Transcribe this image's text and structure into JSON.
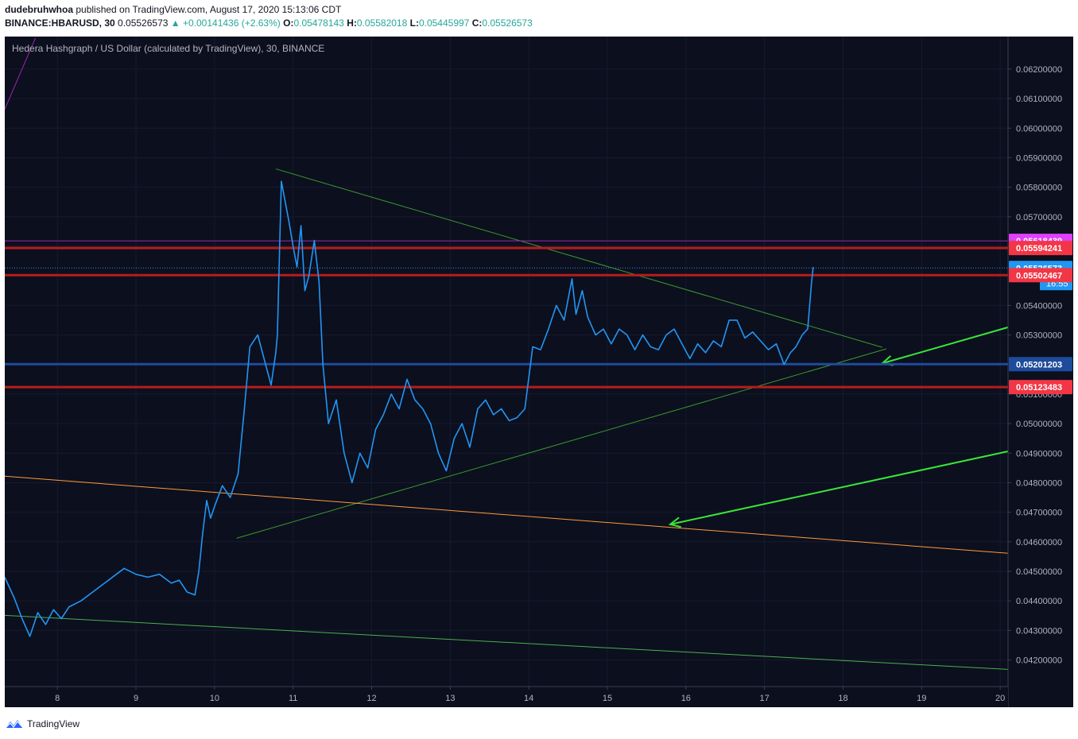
{
  "header": {
    "publisher": "dudebruhwhoa",
    "published_text": "published on TradingView.com, August 17, 2020 15:13:06 CDT",
    "symbol": "BINANCE:HBARUSD, 30",
    "last": "0.05526573",
    "change": "▲ +0.00141436 (+2.63%)",
    "o_label": "O:",
    "o_val": "0.05478143",
    "h_label": "H:",
    "h_val": "0.05582018",
    "l_label": "L:",
    "l_val": "0.05445997",
    "c_label": "C:",
    "c_val": "0.05526573"
  },
  "chart_title": "Hedera Hashgraph / US Dollar (calculated by TradingView), 30, BINANCE",
  "footer": {
    "brand": "TradingView"
  },
  "chart_data": {
    "type": "line",
    "xlabel": "",
    "ylabel": "",
    "xlim": [
      7.33,
      20.1
    ],
    "ylim": [
      0.0411,
      0.0631
    ],
    "x_ticks": [
      "8",
      "9",
      "10",
      "11",
      "12",
      "13",
      "14",
      "15",
      "16",
      "17",
      "18",
      "19",
      "20"
    ],
    "x_tick_values": [
      8,
      9,
      10,
      11,
      12,
      13,
      14,
      15,
      16,
      17,
      18,
      19,
      20
    ],
    "y_ticks": [
      "0.04200000",
      "0.04300000",
      "0.04400000",
      "0.04500000",
      "0.04600000",
      "0.04700000",
      "0.04800000",
      "0.04900000",
      "0.05000000",
      "0.05100000",
      "0.05200000",
      "0.05300000",
      "0.05400000",
      "0.05500000",
      "0.05600000",
      "0.05700000",
      "0.05800000",
      "0.05900000",
      "0.06000000",
      "0.06100000",
      "0.06200000"
    ],
    "y_tick_values": [
      0.042,
      0.043,
      0.044,
      0.045,
      0.046,
      0.047,
      0.048,
      0.049,
      0.05,
      0.051,
      0.052,
      0.053,
      0.054,
      0.055,
      0.056,
      0.057,
      0.058,
      0.059,
      0.06,
      0.061,
      0.062
    ],
    "series": [
      {
        "color": "#2196f3",
        "x": [
          7.33,
          7.45,
          7.55,
          7.65,
          7.75,
          7.85,
          7.95,
          8.05,
          8.15,
          8.3,
          8.45,
          8.6,
          8.75,
          8.85,
          9.0,
          9.15,
          9.3,
          9.45,
          9.55,
          9.65,
          9.75,
          9.8,
          9.85,
          9.9,
          9.95,
          10.0,
          10.1,
          10.2,
          10.3,
          10.38,
          10.45,
          10.55,
          10.65,
          10.72,
          10.78,
          10.8,
          10.85,
          10.9,
          10.95,
          11.0,
          11.05,
          11.1,
          11.15,
          11.2,
          11.27,
          11.33,
          11.38,
          11.45,
          11.55,
          11.65,
          11.75,
          11.85,
          11.95,
          12.05,
          12.15,
          12.25,
          12.35,
          12.45,
          12.55,
          12.65,
          12.75,
          12.85,
          12.95,
          13.05,
          13.15,
          13.25,
          13.35,
          13.45,
          13.55,
          13.65,
          13.75,
          13.85,
          13.95,
          14.05,
          14.15,
          14.25,
          14.35,
          14.45,
          14.55,
          14.6,
          14.68,
          14.75,
          14.85,
          14.95,
          15.05,
          15.15,
          15.25,
          15.35,
          15.45,
          15.55,
          15.65,
          15.75,
          15.85,
          15.95,
          16.05,
          16.15,
          16.25,
          16.35,
          16.45,
          16.55,
          16.65,
          16.75,
          16.85,
          16.95,
          17.05,
          17.15,
          17.25,
          17.33,
          17.4,
          17.48,
          17.55,
          17.6,
          17.62
        ],
        "y": [
          0.0448,
          0.0441,
          0.0434,
          0.0428,
          0.0436,
          0.0432,
          0.0437,
          0.0434,
          0.0438,
          0.044,
          0.0443,
          0.0446,
          0.0449,
          0.0451,
          0.0449,
          0.0448,
          0.0449,
          0.0446,
          0.0447,
          0.0443,
          0.0442,
          0.045,
          0.0463,
          0.0474,
          0.0468,
          0.0472,
          0.0479,
          0.0475,
          0.0483,
          0.0505,
          0.0526,
          0.053,
          0.052,
          0.0513,
          0.0524,
          0.053,
          0.0582,
          0.0575,
          0.0568,
          0.056,
          0.0553,
          0.0567,
          0.0545,
          0.055,
          0.0562,
          0.0548,
          0.052,
          0.05,
          0.0508,
          0.049,
          0.048,
          0.049,
          0.0485,
          0.0498,
          0.0503,
          0.051,
          0.0505,
          0.0515,
          0.0508,
          0.0505,
          0.05,
          0.049,
          0.0484,
          0.0495,
          0.05,
          0.0492,
          0.0505,
          0.0508,
          0.0503,
          0.0505,
          0.0501,
          0.0502,
          0.0505,
          0.0526,
          0.0525,
          0.0532,
          0.054,
          0.0535,
          0.0549,
          0.0537,
          0.0545,
          0.0536,
          0.053,
          0.0532,
          0.0527,
          0.0532,
          0.053,
          0.0525,
          0.053,
          0.0526,
          0.0525,
          0.053,
          0.0532,
          0.0527,
          0.0522,
          0.0527,
          0.0524,
          0.0528,
          0.0526,
          0.0535,
          0.0535,
          0.0529,
          0.0531,
          0.0528,
          0.0525,
          0.0527,
          0.052,
          0.0524,
          0.0526,
          0.053,
          0.0532,
          0.0548,
          0.0553
        ]
      }
    ],
    "drawings": [
      {
        "kind": "upper-trendline",
        "color": "#3a9b2c",
        "x": [
          10.78,
          18.5
        ],
        "y": [
          0.05862,
          0.05258
        ]
      },
      {
        "kind": "lower-trendline",
        "color": "#3a9b2c",
        "x": [
          10.28,
          18.55
        ],
        "y": [
          0.04612,
          0.05253
        ]
      },
      {
        "kind": "orange-channel",
        "color": "#ff9a3c",
        "x": [
          7.33,
          20.1
        ],
        "y": [
          0.04822,
          0.04561
        ]
      },
      {
        "kind": "green-channel",
        "color": "#4caf50",
        "x": [
          7.33,
          20.1
        ],
        "y": [
          0.04351,
          0.04168
        ]
      },
      {
        "kind": "purple-curve",
        "color": "#9c27b0",
        "x": [
          7.33,
          7.72
        ],
        "y": [
          0.06064,
          0.06305
        ]
      },
      {
        "kind": "arrow-1",
        "color": "#39e639",
        "x": [
          20.1,
          18.5
        ],
        "y": [
          0.05326,
          0.05204
        ]
      },
      {
        "kind": "arrow-2",
        "color": "#39e639",
        "x": [
          20.1,
          15.8
        ],
        "y": [
          0.04906,
          0.04659
        ]
      }
    ],
    "levels": [
      {
        "value": 0.05618439,
        "label": "0.05618439",
        "color": "#e040fb",
        "line": "#9c27b0",
        "style": "solid"
      },
      {
        "value": 0.05594241,
        "label": "0.05594241",
        "color": "#f23645",
        "line": "#b71c1c",
        "style": "thick"
      },
      {
        "value": 0.05526573,
        "label": "0.05526573",
        "color": "#2196f3",
        "line": "#2196f3",
        "style": "dotted"
      },
      {
        "value": 0.05502467,
        "label": "0.05502467",
        "color": "#f23645",
        "line": "#b71c1c",
        "style": "thick"
      },
      {
        "value": 0.05201203,
        "label": "0.05201203",
        "color": "#1e4b9c",
        "line": "#1e4b9c",
        "style": "thick"
      },
      {
        "value": 0.05123483,
        "label": "0.05123483",
        "color": "#f23645",
        "line": "#b71c1c",
        "style": "thick"
      }
    ],
    "countdown": "16:55"
  }
}
